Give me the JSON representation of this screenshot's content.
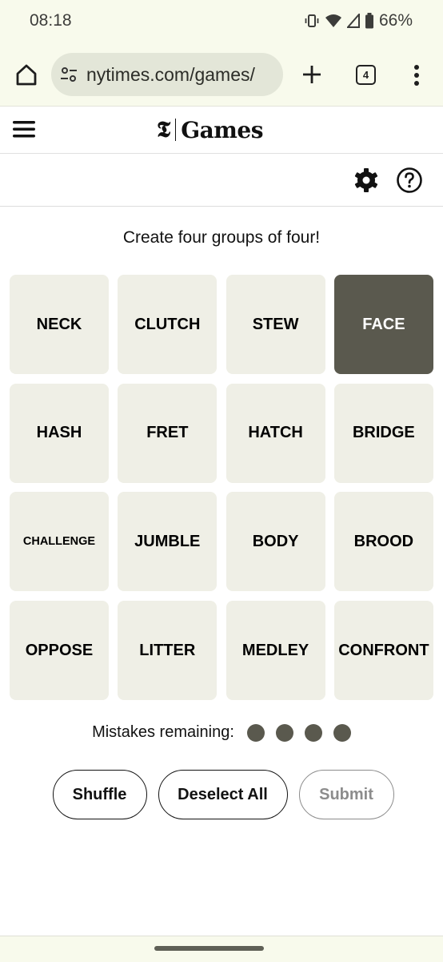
{
  "status_bar": {
    "time": "08:18",
    "battery": "66%",
    "icons": [
      "vibrate-icon",
      "wifi-icon",
      "signal-icon",
      "battery-icon"
    ]
  },
  "browser": {
    "url": "nytimes.com/games/",
    "tab_count": "4"
  },
  "site_header": {
    "logo_mark": "𝕿",
    "logo_text": "Games"
  },
  "game": {
    "instructions": "Create four groups of four!",
    "tiles": [
      {
        "word": "NECK",
        "selected": false
      },
      {
        "word": "CLUTCH",
        "selected": false
      },
      {
        "word": "STEW",
        "selected": false
      },
      {
        "word": "FACE",
        "selected": true
      },
      {
        "word": "HASH",
        "selected": false
      },
      {
        "word": "FRET",
        "selected": false
      },
      {
        "word": "HATCH",
        "selected": false
      },
      {
        "word": "BRIDGE",
        "selected": false
      },
      {
        "word": "CHALLENGE",
        "selected": false
      },
      {
        "word": "JUMBLE",
        "selected": false
      },
      {
        "word": "BODY",
        "selected": false
      },
      {
        "word": "BROOD",
        "selected": false
      },
      {
        "word": "OPPOSE",
        "selected": false
      },
      {
        "word": "LITTER",
        "selected": false
      },
      {
        "word": "MEDLEY",
        "selected": false
      },
      {
        "word": "CONFRONT",
        "selected": false
      }
    ],
    "mistakes_label": "Mistakes remaining:",
    "mistakes_remaining": 4,
    "buttons": {
      "shuffle": "Shuffle",
      "deselect_all": "Deselect All",
      "submit": "Submit"
    },
    "colors": {
      "tile": "#efefe6",
      "tile_selected": "#5a594e",
      "dot": "#5a594e"
    }
  }
}
